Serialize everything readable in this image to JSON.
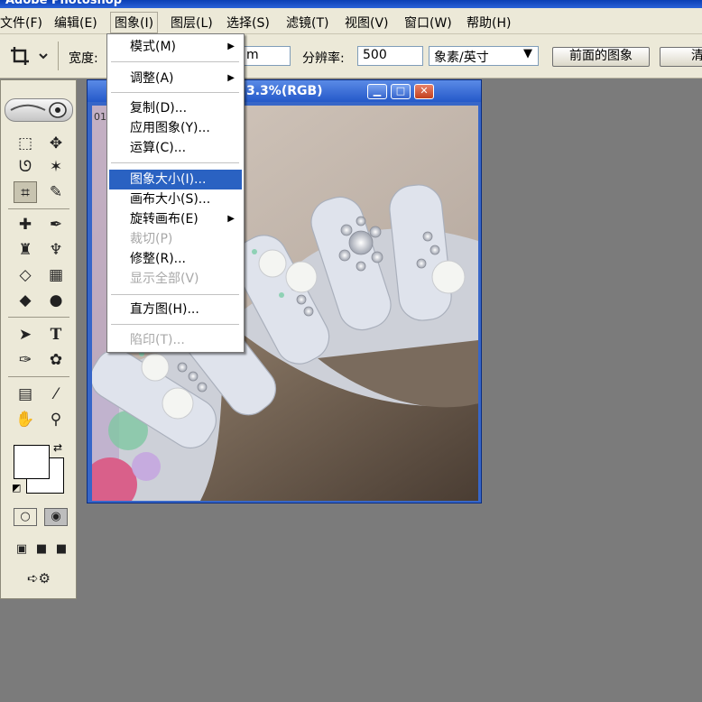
{
  "app": {
    "title": "Adobe Photoshop"
  },
  "menubar": {
    "items": [
      "文件(F)",
      "编辑(E)",
      "图象(I)",
      "图层(L)",
      "选择(S)",
      "滤镜(T)",
      "视图(V)",
      "窗口(W)",
      "帮助(H)"
    ],
    "active_index": 2
  },
  "options": {
    "width_label": "宽度:",
    "width_unit": "m",
    "resolution_label": "分辨率:",
    "resolution_value": "500",
    "resolution_unit": "象素/英寸",
    "front_image_button": "前面的图象",
    "clear_button": "清"
  },
  "document": {
    "title": "3.3%(RGB)",
    "side_text": "01"
  },
  "image_menu": {
    "items": [
      {
        "label": "模式(M)",
        "submenu": true,
        "disabled": false
      },
      {
        "label": "调整(A)",
        "submenu": true,
        "disabled": false
      },
      {
        "label": "复制(D)...",
        "submenu": false,
        "disabled": false
      },
      {
        "label": "应用图象(Y)...",
        "submenu": false,
        "disabled": false
      },
      {
        "label": "运算(C)...",
        "submenu": false,
        "disabled": false
      },
      {
        "label": "图象大小(I)...",
        "submenu": false,
        "disabled": false,
        "highlighted": true
      },
      {
        "label": "画布大小(S)...",
        "submenu": false,
        "disabled": false
      },
      {
        "label": "旋转画布(E)",
        "submenu": true,
        "disabled": false
      },
      {
        "label": "裁切(P)",
        "submenu": false,
        "disabled": true
      },
      {
        "label": "修整(R)...",
        "submenu": false,
        "disabled": false
      },
      {
        "label": "显示全部(V)",
        "submenu": false,
        "disabled": true
      },
      {
        "label": "直方图(H)...",
        "submenu": false,
        "disabled": false
      },
      {
        "label": "陷印(T)...",
        "submenu": false,
        "disabled": true
      }
    ]
  },
  "colors": {
    "highlight": "#2a62c2",
    "titlebar": "#2a62d8",
    "workspace": "#7b7b7b",
    "menu_face": "#ece9d8"
  }
}
